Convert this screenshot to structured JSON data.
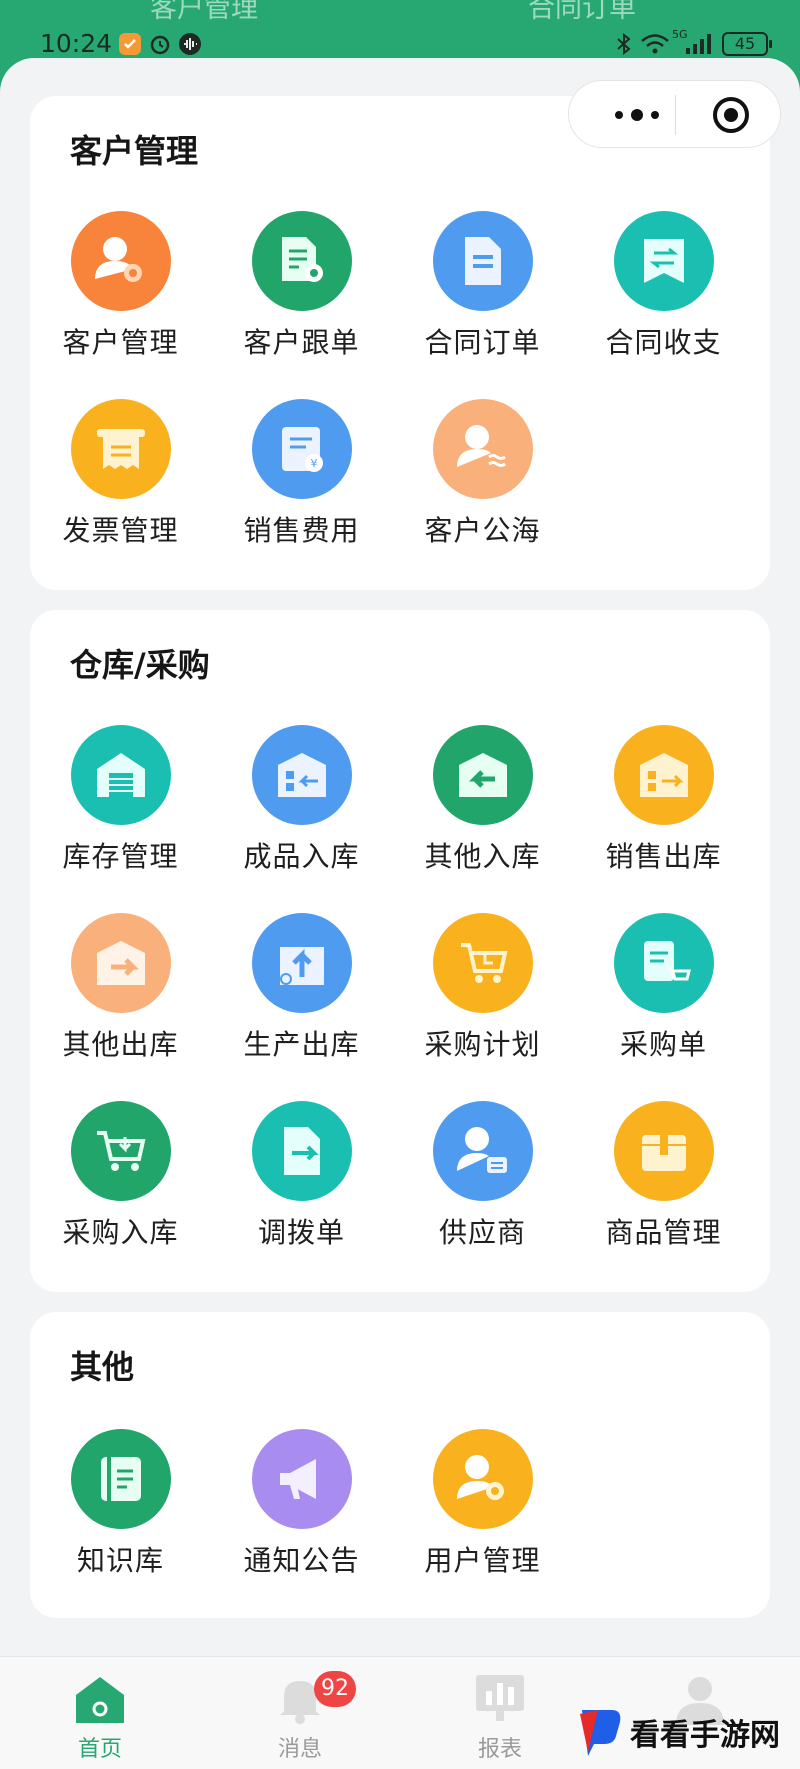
{
  "header_ghost": {
    "left_tab": "客户管理",
    "right_tab": "合同订单"
  },
  "status_bar": {
    "time": "10:24",
    "network": "5G",
    "battery": "45"
  },
  "capsule": {
    "more_icon": "more-dots-icon",
    "close_icon": "target-close-icon"
  },
  "sections": [
    {
      "title": "客户管理",
      "items": [
        {
          "label": "客户管理",
          "color": "#f7843a",
          "icon": "user-gear-icon"
        },
        {
          "label": "客户跟单",
          "color": "#22a56b",
          "icon": "doc-target-icon"
        },
        {
          "label": "合同订单",
          "color": "#4e9bf0",
          "icon": "document-icon"
        },
        {
          "label": "合同收支",
          "color": "#1bbfb2",
          "icon": "exchange-icon"
        },
        {
          "label": "发票管理",
          "color": "#f9b21d",
          "icon": "invoice-icon"
        },
        {
          "label": "销售费用",
          "color": "#4e9bf0",
          "icon": "expense-icon"
        },
        {
          "label": "客户公海",
          "color": "#f9b07a",
          "icon": "user-sea-icon"
        }
      ]
    },
    {
      "title": "仓库/采购",
      "items": [
        {
          "label": "库存管理",
          "color": "#1bbfb2",
          "icon": "warehouse-icon"
        },
        {
          "label": "成品入库",
          "color": "#4e9bf0",
          "icon": "inbound-icon"
        },
        {
          "label": "其他入库",
          "color": "#22a56b",
          "icon": "inbound-arrow-icon"
        },
        {
          "label": "销售出库",
          "color": "#f9b21d",
          "icon": "outbound-icon"
        },
        {
          "label": "其他出库",
          "color": "#f9b07a",
          "icon": "outbound-arrow-icon"
        },
        {
          "label": "生产出库",
          "color": "#4e9bf0",
          "icon": "upload-tray-icon"
        },
        {
          "label": "采购计划",
          "color": "#f9b21d",
          "icon": "cart-clock-icon"
        },
        {
          "label": "采购单",
          "color": "#1bbfb2",
          "icon": "clipboard-cart-icon"
        },
        {
          "label": "采购入库",
          "color": "#22a56b",
          "icon": "cart-down-icon"
        },
        {
          "label": "调拨单",
          "color": "#1bbfb2",
          "icon": "transfer-doc-icon"
        },
        {
          "label": "供应商",
          "color": "#4e9bf0",
          "icon": "supplier-icon"
        },
        {
          "label": "商品管理",
          "color": "#f9b21d",
          "icon": "box-icon"
        }
      ]
    },
    {
      "title": "其他",
      "items": [
        {
          "label": "知识库",
          "color": "#22a56b",
          "icon": "book-icon"
        },
        {
          "label": "通知公告",
          "color": "#a98cf0",
          "icon": "megaphone-icon"
        },
        {
          "label": "用户管理",
          "color": "#f9b21d",
          "icon": "user-settings-icon"
        }
      ]
    }
  ],
  "bottom_nav": {
    "items": [
      {
        "label": "首页",
        "active": true,
        "icon": "home-icon"
      },
      {
        "label": "消息",
        "active": false,
        "icon": "bell-icon",
        "badge": "92"
      },
      {
        "label": "报表",
        "active": false,
        "icon": "chart-icon"
      },
      {
        "label": "",
        "active": false,
        "icon": "profile-icon"
      }
    ]
  },
  "watermark": {
    "text": "看看手游网"
  },
  "colors": {
    "brand_green": "#27a872",
    "background": "#f2f3f5",
    "badge_red": "#f04545"
  }
}
